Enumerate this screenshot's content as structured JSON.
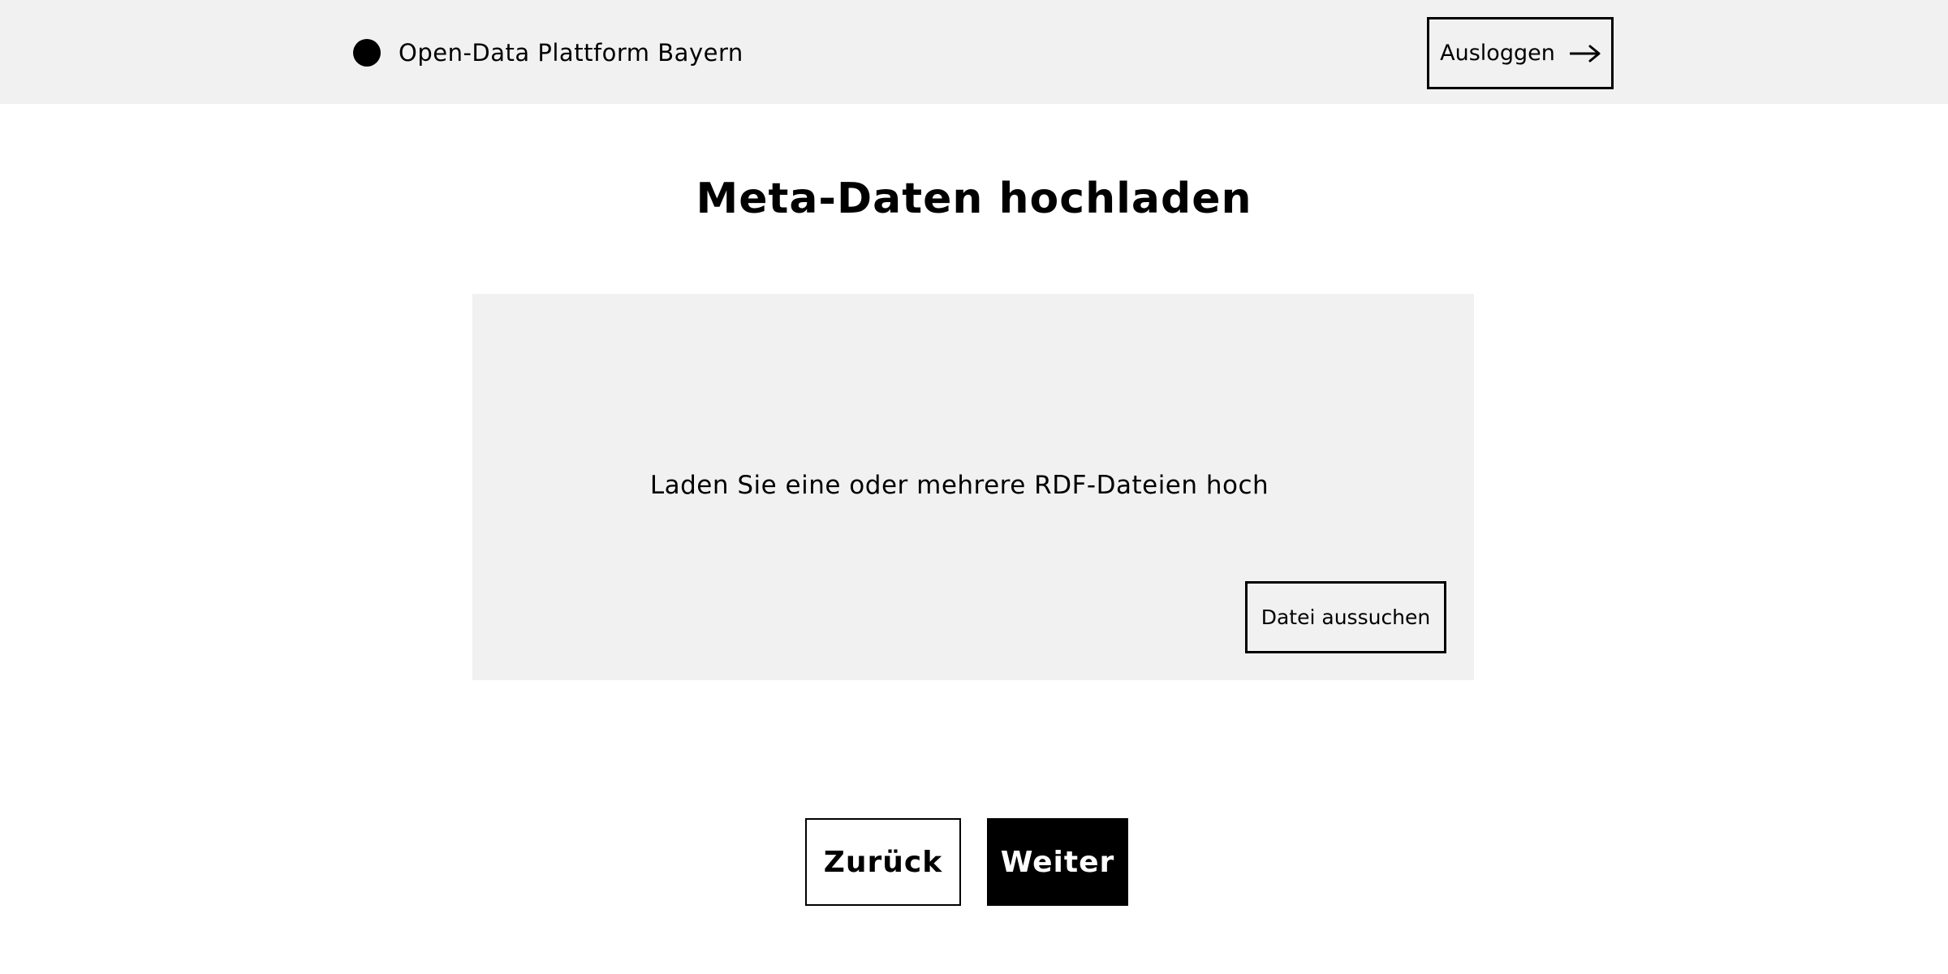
{
  "header": {
    "brand_name": "Open-Data Plattform Bayern",
    "logout_label": "Ausloggen",
    "logout_icon": "arrow-right-icon",
    "brand_icon": "logo-dot-icon"
  },
  "main": {
    "title": "Meta-Daten hochladen",
    "upload": {
      "instruction": "Laden Sie eine oder mehrere RDF-Dateien hoch",
      "file_button_label": "Datei aussuchen"
    }
  },
  "navigation": {
    "back_label": "Zurück",
    "next_label": "Weiter"
  },
  "colors": {
    "panel_background": "#f1f1f1",
    "primary": "#000000",
    "background": "#ffffff"
  }
}
